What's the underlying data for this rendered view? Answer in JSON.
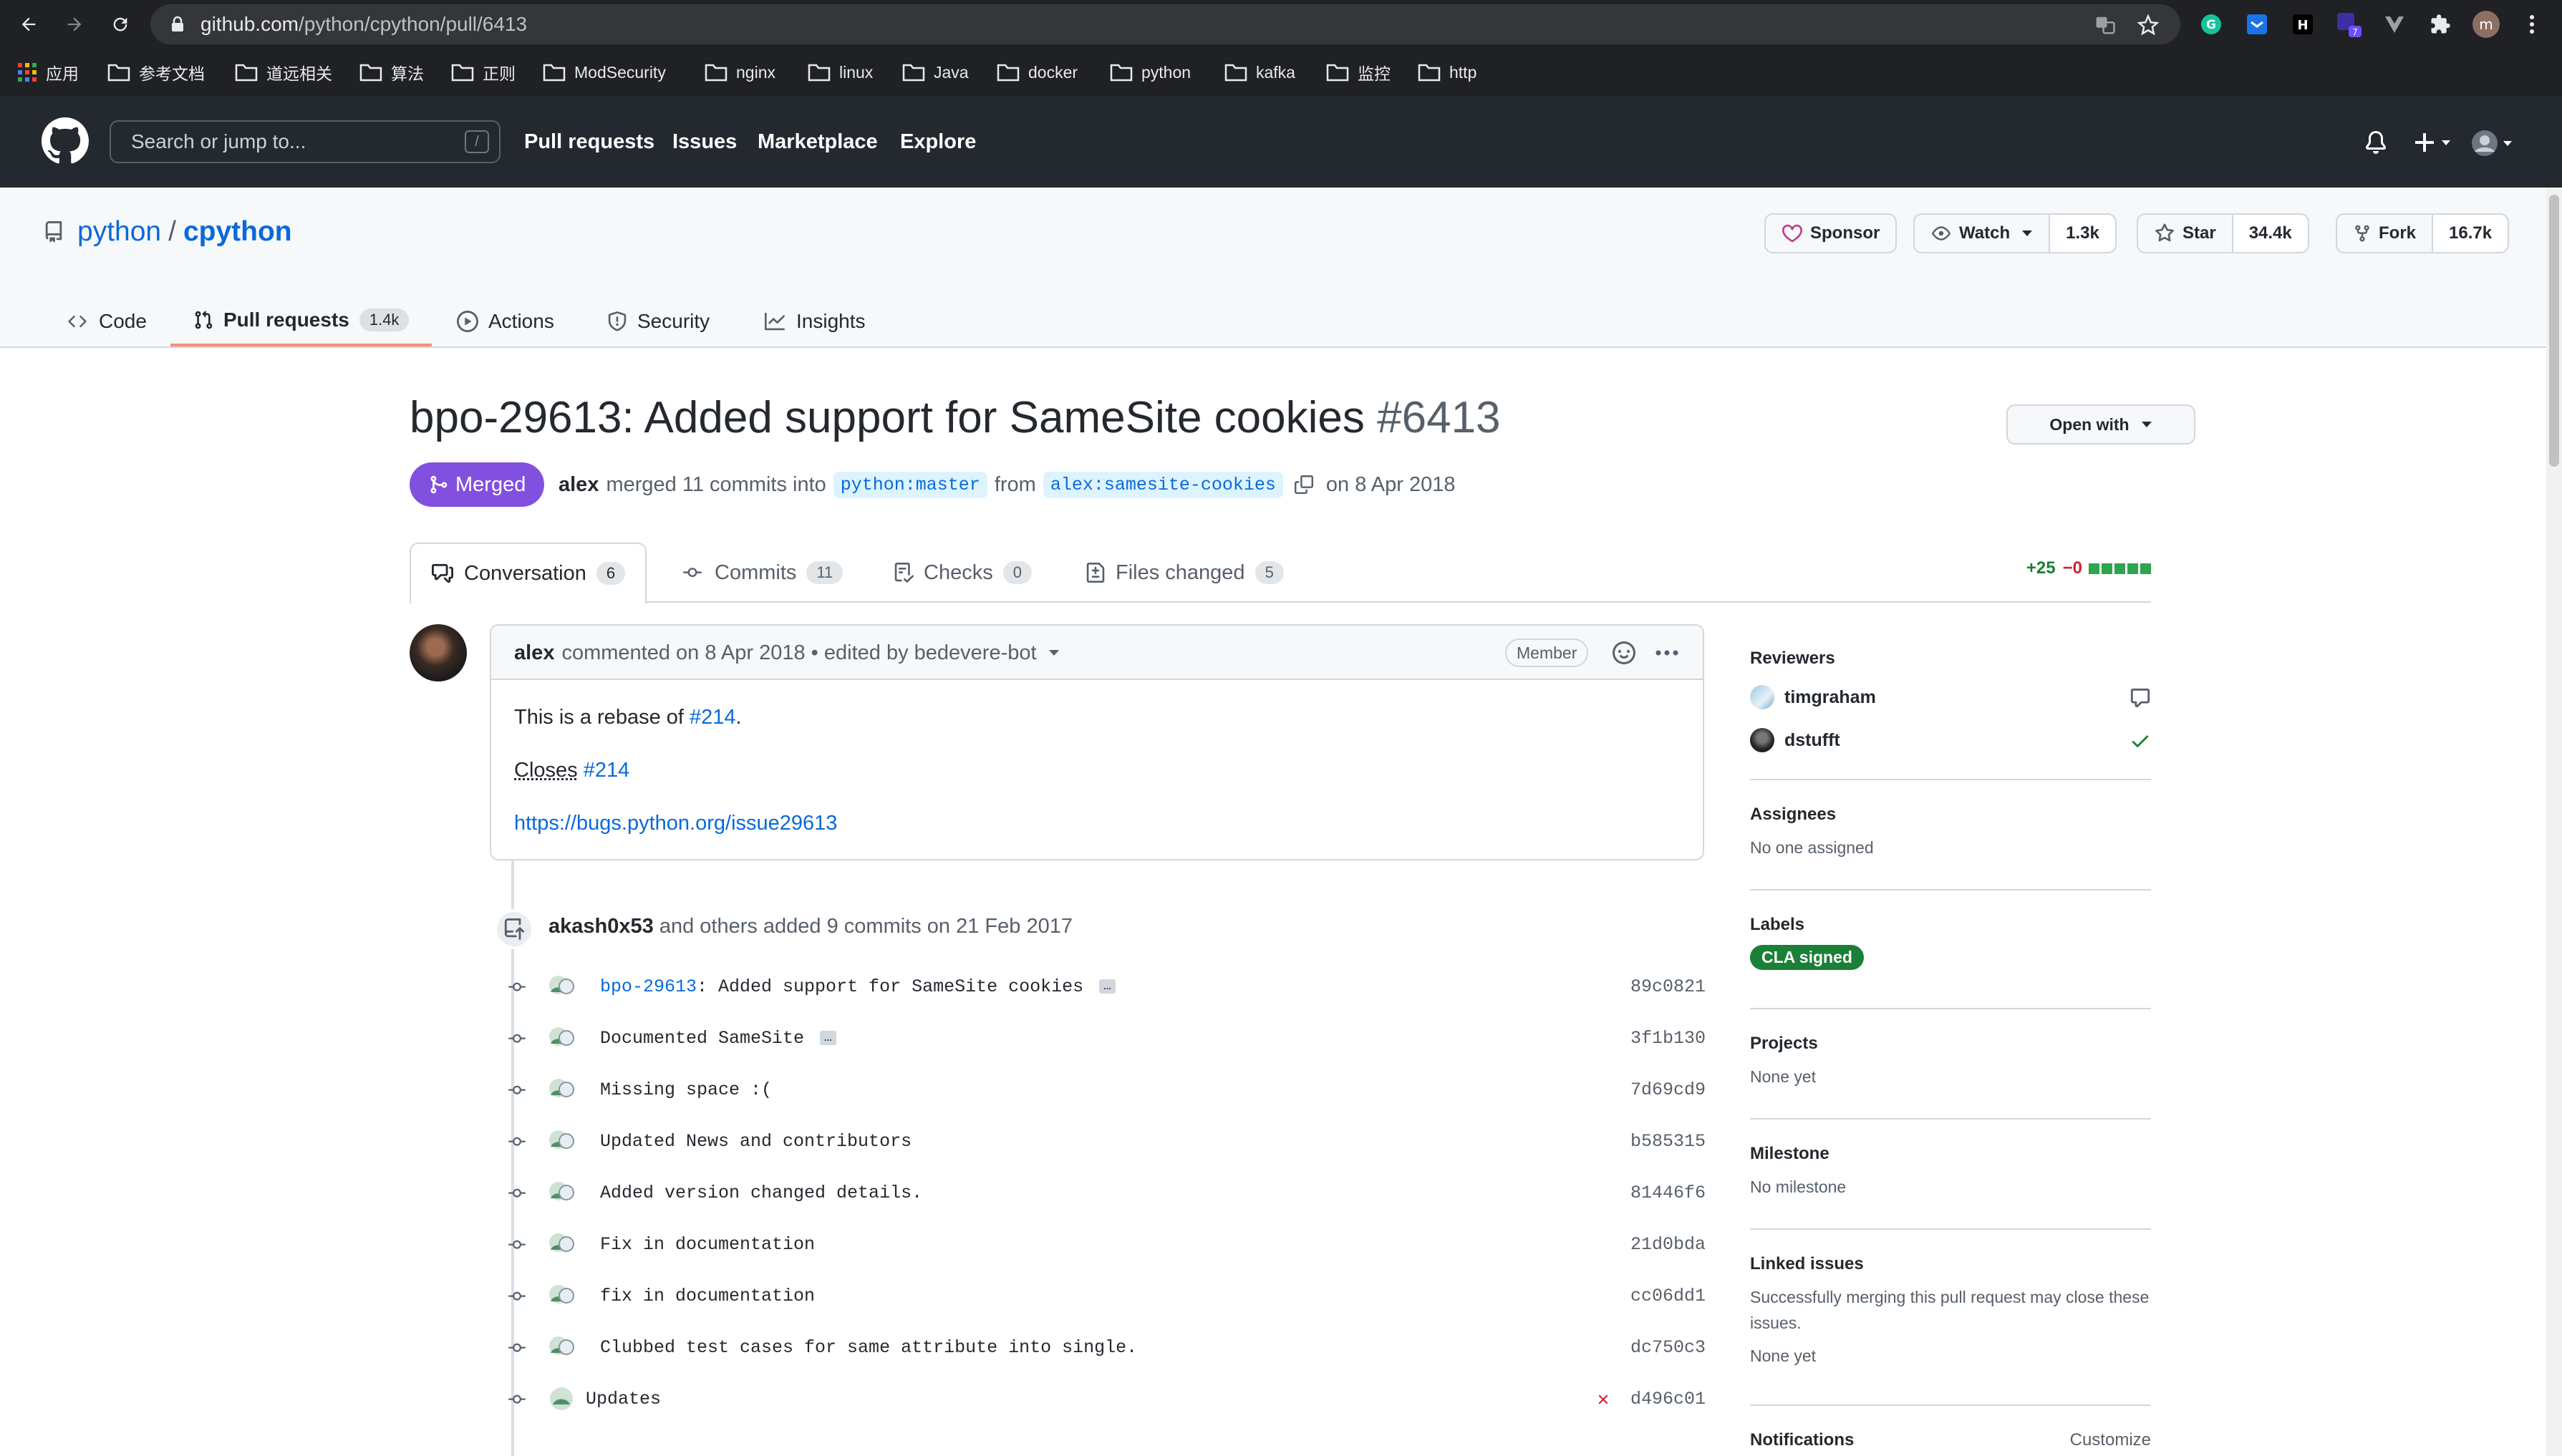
{
  "browser": {
    "url_domain": "github.com",
    "url_path": "/python/cpython/pull/6413",
    "profile_initial": "m",
    "ext_badge": "7",
    "bookmarks": [
      "应用",
      "参考文档",
      "道远相关",
      "算法",
      "正则",
      "ModSecurity",
      "nginx",
      "linux",
      "Java",
      "docker",
      "python",
      "kafka",
      "监控",
      "http"
    ]
  },
  "header": {
    "search_placeholder": "Search or jump to...",
    "search_key": "/",
    "nav": [
      "Pull requests",
      "Issues",
      "Marketplace",
      "Explore"
    ]
  },
  "repo": {
    "owner": "python",
    "separator": "/",
    "name": "cpython",
    "sponsor_label": "Sponsor",
    "watch_label": "Watch",
    "watch_count": "1.3k",
    "star_label": "Star",
    "star_count": "34.4k",
    "fork_label": "Fork",
    "fork_count": "16.7k",
    "tabs": {
      "code": "Code",
      "pulls": "Pull requests",
      "pulls_count": "1.4k",
      "actions": "Actions",
      "security": "Security",
      "insights": "Insights"
    }
  },
  "pr": {
    "title": "bpo-29613: Added support for SameSite cookies",
    "number": "#6413",
    "open_with": "Open with",
    "state": "Merged",
    "author": "alex",
    "merged_text": "merged 11 commits into",
    "base_branch": "python:master",
    "from_text": "from",
    "head_branch": "alex:samesite-cookies",
    "date_text": "on 8 Apr 2018",
    "tabs": {
      "conversation": "Conversation",
      "conversation_count": "6",
      "commits": "Commits",
      "commits_count": "11",
      "checks": "Checks",
      "checks_count": "0",
      "files": "Files changed",
      "files_count": "5"
    },
    "additions": "+25",
    "deletions": "−0"
  },
  "comment": {
    "author": "alex",
    "meta": "commented on 8 Apr 2018 • edited by bedevere-bot",
    "role": "Member",
    "line1_text": "This is a rebase of",
    "line1_link": "#214",
    "line1_end": ".",
    "line2_text": "Closes",
    "line2_link": "#214",
    "line3_link": "https://bugs.python.org/issue29613"
  },
  "timeline": {
    "push_author": "akash0x53",
    "push_text": "and others added 9 commits on 21 Feb 2017",
    "commits": [
      {
        "link": "bpo-29613",
        "msg": ": Added support for SameSite cookies",
        "ellipsis": "…",
        "sha": "89c0821"
      },
      {
        "link": "",
        "msg": "Documented SameSite",
        "ellipsis": "…",
        "sha": "3f1b130"
      },
      {
        "link": "",
        "msg": "Missing space :(",
        "ellipsis": "",
        "sha": "7d69cd9"
      },
      {
        "link": "",
        "msg": "Updated News and contributors",
        "ellipsis": "",
        "sha": "b585315"
      },
      {
        "link": "",
        "msg": "Added version changed details.",
        "ellipsis": "",
        "sha": "81446f6"
      },
      {
        "link": "",
        "msg": "Fix in documentation",
        "ellipsis": "",
        "sha": "21d0bda"
      },
      {
        "link": "",
        "msg": "fix in documentation",
        "ellipsis": "",
        "sha": "cc06dd1"
      },
      {
        "link": "",
        "msg": "Clubbed test cases for same attribute into single.",
        "ellipsis": "",
        "sha": "dc750c3"
      },
      {
        "link": "",
        "msg": "Updates",
        "ellipsis": "",
        "sha": "d496c01",
        "status": "fail"
      }
    ]
  },
  "sidebar": {
    "reviewers_label": "Reviewers",
    "reviewers": [
      {
        "name": "timgraham",
        "status": "commented"
      },
      {
        "name": "dstufft",
        "status": "approved"
      }
    ],
    "assignees_label": "Assignees",
    "assignees_value": "No one assigned",
    "labels_label": "Labels",
    "label": "CLA signed",
    "projects_label": "Projects",
    "projects_value": "None yet",
    "milestone_label": "Milestone",
    "milestone_value": "No milestone",
    "linked_label": "Linked issues",
    "linked_text": "Successfully merging this pull request may close these issues.",
    "linked_value": "None yet",
    "notifications_label": "Notifications",
    "customize_label": "Customize"
  },
  "colors": {
    "accent": "#0969da",
    "merged": "#8250df",
    "success": "#1a7f37",
    "danger": "#cf222e",
    "header": "#24292f"
  }
}
